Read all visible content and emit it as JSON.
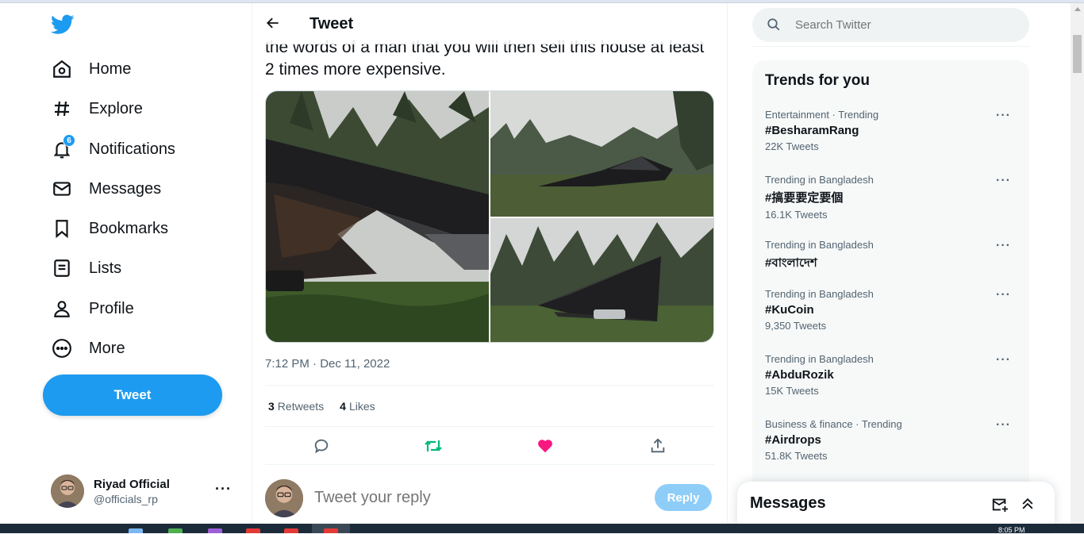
{
  "nav": {
    "items": [
      {
        "label": "Home",
        "icon": "home-icon"
      },
      {
        "label": "Explore",
        "icon": "hashtag-icon"
      },
      {
        "label": "Notifications",
        "icon": "bell-icon",
        "badge": "6"
      },
      {
        "label": "Messages",
        "icon": "envelope-icon"
      },
      {
        "label": "Bookmarks",
        "icon": "bookmark-icon"
      },
      {
        "label": "Lists",
        "icon": "list-icon"
      },
      {
        "label": "Profile",
        "icon": "person-icon"
      },
      {
        "label": "More",
        "icon": "more-circle-icon"
      }
    ],
    "tweet_button": "Tweet"
  },
  "account": {
    "name": "Riyad Official",
    "handle": "@officials_rp",
    "more": "···"
  },
  "header": {
    "title": "Tweet"
  },
  "tweet": {
    "text": "the words of a man that you will then sell this house at least 2 times more expensive.",
    "timestamp": "7:12 PM · Dec 11, 2022",
    "retweets": "3",
    "retweets_label": "Retweets",
    "likes": "4",
    "likes_label": "Likes"
  },
  "reply": {
    "placeholder": "Tweet your reply",
    "button": "Reply"
  },
  "search": {
    "placeholder": "Search Twitter"
  },
  "trends": {
    "title": "Trends for you",
    "items": [
      {
        "context": "Entertainment · Trending",
        "name": "#BesharamRang",
        "count": "22K Tweets"
      },
      {
        "context": "Trending in Bangladesh",
        "name": "#搞要要定要個",
        "count": "16.1K Tweets"
      },
      {
        "context": "Trending in Bangladesh",
        "name": "#বাংলাদেশ",
        "count": ""
      },
      {
        "context": "Trending in Bangladesh",
        "name": "#KuCoin",
        "count": "9,350 Tweets"
      },
      {
        "context": "Trending in Bangladesh",
        "name": "#AbduRozik",
        "count": "15K Tweets"
      },
      {
        "context": "Business & finance · Trending",
        "name": "#Airdrops",
        "count": "51.8K Tweets"
      }
    ],
    "more": "···"
  },
  "messages_drawer": {
    "title": "Messages"
  },
  "taskbar": {
    "clock": "8:05 PM"
  },
  "colors": {
    "accent": "#1d9bf0",
    "retweet": "#00ba7c",
    "like": "#f91880",
    "text_secondary": "#536471"
  }
}
